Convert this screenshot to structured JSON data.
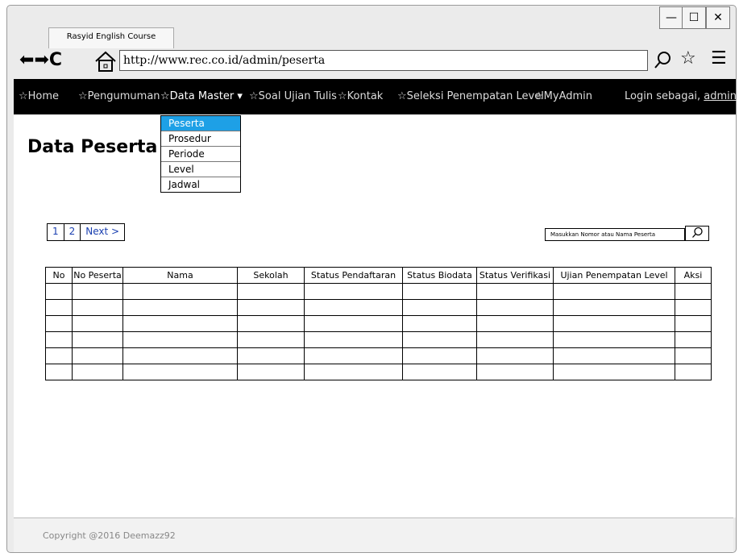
{
  "browser": {
    "tab_title": "Rasyid English Course",
    "url": "http://www.rec.co.id/admin/peserta",
    "window_buttons": [
      "minimize-icon",
      "maximize-icon",
      "close-icon"
    ]
  },
  "nav": {
    "items": [
      "☆Home",
      "☆Pengumuman",
      "☆Data Master",
      "☆Soal Ujian Tulis",
      "☆Kontak",
      "☆Seleksi Penempatan Level",
      "☆MyAdmin"
    ],
    "login_prefix": "Login sebagai, ",
    "login_user": "admin"
  },
  "dropdown": {
    "items": [
      "Peserta",
      "Prosedur",
      "Periode",
      "Level",
      "Jadwal"
    ],
    "active": "Peserta"
  },
  "page": {
    "title": "Data Peserta"
  },
  "pager": {
    "pages": [
      "1",
      "2"
    ],
    "next": "Next >"
  },
  "search": {
    "placeholder": "Masukkan Nomor atau Nama Peserta"
  },
  "table": {
    "headers": [
      "No",
      "No Peserta",
      "Nama",
      "Sekolah",
      "Status Pendaftaran",
      "Status Biodata",
      "Status Verifikasi",
      "Ujian Penempatan Level",
      "Aksi"
    ],
    "empty_rows": 6
  },
  "footer": {
    "text": "Copyright @2016 Deemazz92"
  },
  "colors": {
    "menu_bg": "#000000",
    "dropdown_active": "#1ea0e6",
    "link": "#1a3fb0"
  }
}
